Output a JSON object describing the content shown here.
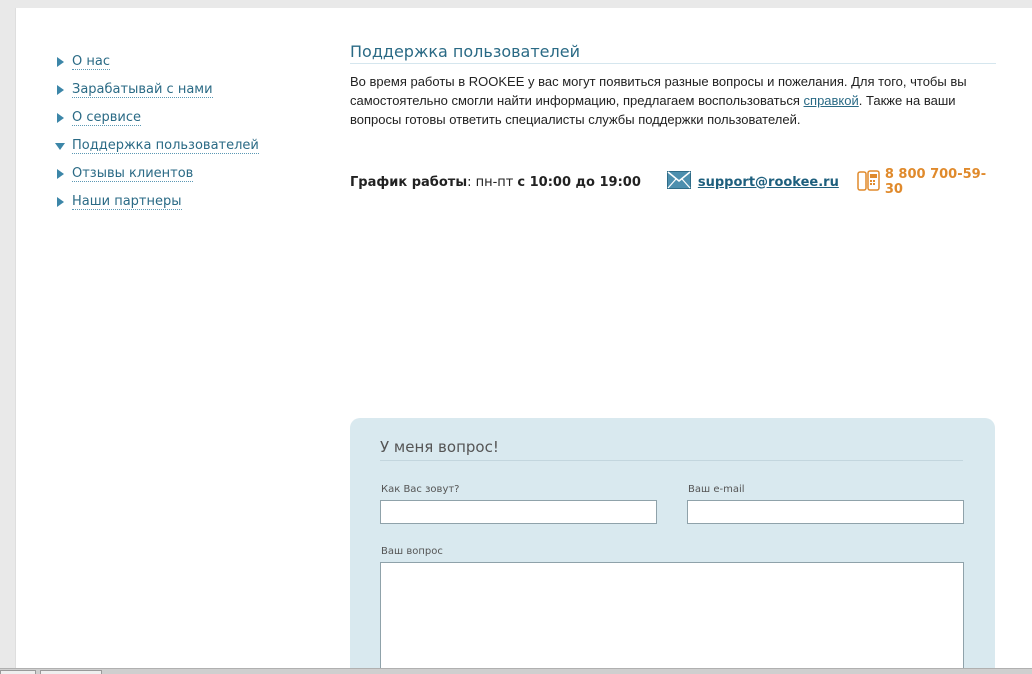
{
  "sidebar": {
    "items": [
      {
        "label": "О нас",
        "active": false
      },
      {
        "label": "Зарабатывай с нами",
        "active": false
      },
      {
        "label": "О сервисе",
        "active": false
      },
      {
        "label": "Поддержка пользователей",
        "active": true
      },
      {
        "label": "Отзывы клиентов",
        "active": false
      },
      {
        "label": "Наши партнеры",
        "active": false
      }
    ]
  },
  "main": {
    "title": "Поддержка пользователей",
    "intro_before_link": "Во время работы в ROOKEE у вас могут появиться разные вопросы и пожелания. Для того, чтобы вы самостоятельно смогли найти информацию, предлагаем воспользоваться ",
    "intro_link": "справкой",
    "intro_after_link": ". Также на ваши вопросы готовы ответить специалисты службы поддержки пользователей.",
    "schedule_label": "График работы",
    "schedule_days": ": пн-пт",
    "schedule_hours": "с 10:00 до 19:00",
    "email": "support@rookee.ru",
    "phone": "8 800 700-59-30",
    "mail_icon": "envelope-icon",
    "phone_icon": "phone-icon",
    "accent_color": "#2a6a85",
    "phone_color": "#e08a2c"
  },
  "form": {
    "title": "У меня вопрос!",
    "name_label": "Как Вас зовут?",
    "name_value": "",
    "email_label": "Ваш e-mail",
    "email_value": "",
    "question_label": "Ваш вопрос",
    "question_value": "",
    "background": "#d9e9ef"
  }
}
